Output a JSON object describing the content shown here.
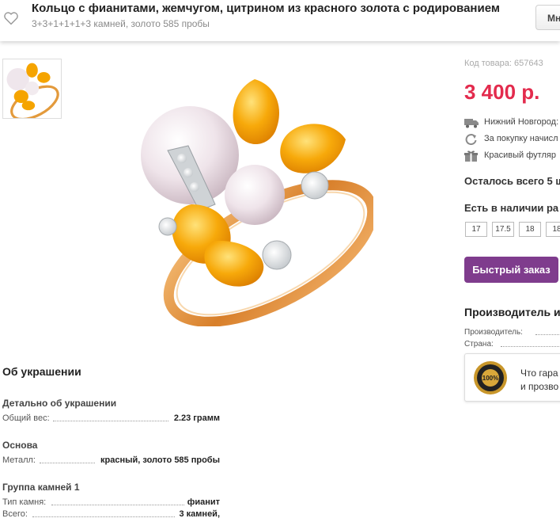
{
  "header": {
    "title": "Кольцо с фианитами, жемчугом, цитрином из красного золота с родированием",
    "subtitle": "3+3+1+1+1+3 камней, золото 585 пробы",
    "button_label": "Мн"
  },
  "product": {
    "sku": "Код товара: 657643",
    "price": "3 400 р.",
    "features": [
      {
        "icon": "truck-icon",
        "text": "Нижний Новгород:"
      },
      {
        "icon": "refresh-icon",
        "text": "За покупку начисл"
      },
      {
        "icon": "gift-icon",
        "text": "Красивый футляр"
      }
    ],
    "stock": "Осталось всего 5 ш",
    "availability_title": "Есть в наличии ра",
    "sizes": [
      "17",
      "17.5",
      "18",
      "18"
    ],
    "quick_order": "Быстрый заказ"
  },
  "manufacturer": {
    "title": "Производитель и",
    "rows": [
      {
        "label": "Производитель:"
      },
      {
        "label": "Страна:"
      }
    ]
  },
  "guarantee": {
    "seal_text": "100%",
    "line1": "Что гара",
    "line2": "и прозво"
  },
  "about": {
    "title": "Об украшении",
    "groups": [
      {
        "title": "Детально об украшении",
        "rows": [
          {
            "label": "Общий вес:",
            "value": "2.23 грамм"
          }
        ]
      },
      {
        "title": "Основа",
        "rows": [
          {
            "label": "Металл:",
            "value": "красный, золото 585 пробы"
          }
        ]
      },
      {
        "title": "Группа камней 1",
        "rows": [
          {
            "label": "Тип камня:",
            "value": "фианит"
          },
          {
            "label": "Всего:",
            "value": "3 камней,"
          }
        ]
      }
    ]
  },
  "colors": {
    "price": "#e32b4d",
    "quick_order_bg": "#7f3c8d",
    "gold": "#e8a23a",
    "citrine": "#f5a400"
  }
}
